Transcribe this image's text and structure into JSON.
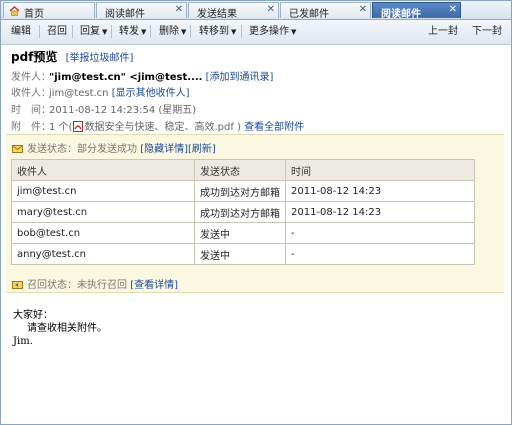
{
  "tabs": [
    {
      "label": "首页"
    },
    {
      "label": "阅读邮件"
    },
    {
      "label": "发送结果"
    },
    {
      "label": "已发邮件"
    },
    {
      "label": "阅读邮件"
    }
  ],
  "toolbar": {
    "edit": "编辑",
    "recall": "召回",
    "reply": "回复",
    "forward": "转发",
    "delete": "删除",
    "move": "转移到",
    "more": "更多操作",
    "prev": "上一封",
    "next": "下一封"
  },
  "mail": {
    "subject": "pdf预览",
    "report_spam": "[举报垃圾邮件]",
    "from_key": "发件人：",
    "from_value": "\"jim@test.cn\" <jim@test....",
    "add_contact": "[添加到通讯录]",
    "to_key": "收件人：",
    "to_value": "jim@test.cn",
    "show_others": "[显示其他收件人]",
    "time_key": "时　间：",
    "time_value": "2011-08-12 14:23:54 (星期五)",
    "attach_key": "附　件：",
    "attach_count": "1 个(",
    "attach_name": "数据安全与快速、稳定、高效.pdf )",
    "view_all": "查看全部附件"
  },
  "send_status": {
    "label": "发送状态：",
    "text": "部分发送成功",
    "hide": "[隐藏详情]",
    "refresh": "[刷新]",
    "columns": [
      "收件人",
      "发送状态",
      "时间"
    ],
    "rows": [
      {
        "recipient": "jim@test.cn",
        "status": "成功到达对方邮箱",
        "time": "2011-08-12 14:23"
      },
      {
        "recipient": "mary@test.cn",
        "status": "成功到达对方邮箱",
        "time": "2011-08-12 14:23"
      },
      {
        "recipient": "bob@test.cn",
        "status": "发送中",
        "time": "-"
      },
      {
        "recipient": "anny@test.cn",
        "status": "发送中",
        "time": "-"
      }
    ],
    "recall_label": "召回状态：",
    "recall_text": "未执行召回",
    "recall_link": "[查看详情]"
  },
  "body": {
    "greeting": "大家好：",
    "line1": "请查收相关附件。",
    "signature": "Jim."
  },
  "colors": {
    "accent": "#3d6aa8",
    "link": "#1c4a9a",
    "success": "#2a8a1e",
    "status_bg": "#fbf8e2"
  }
}
